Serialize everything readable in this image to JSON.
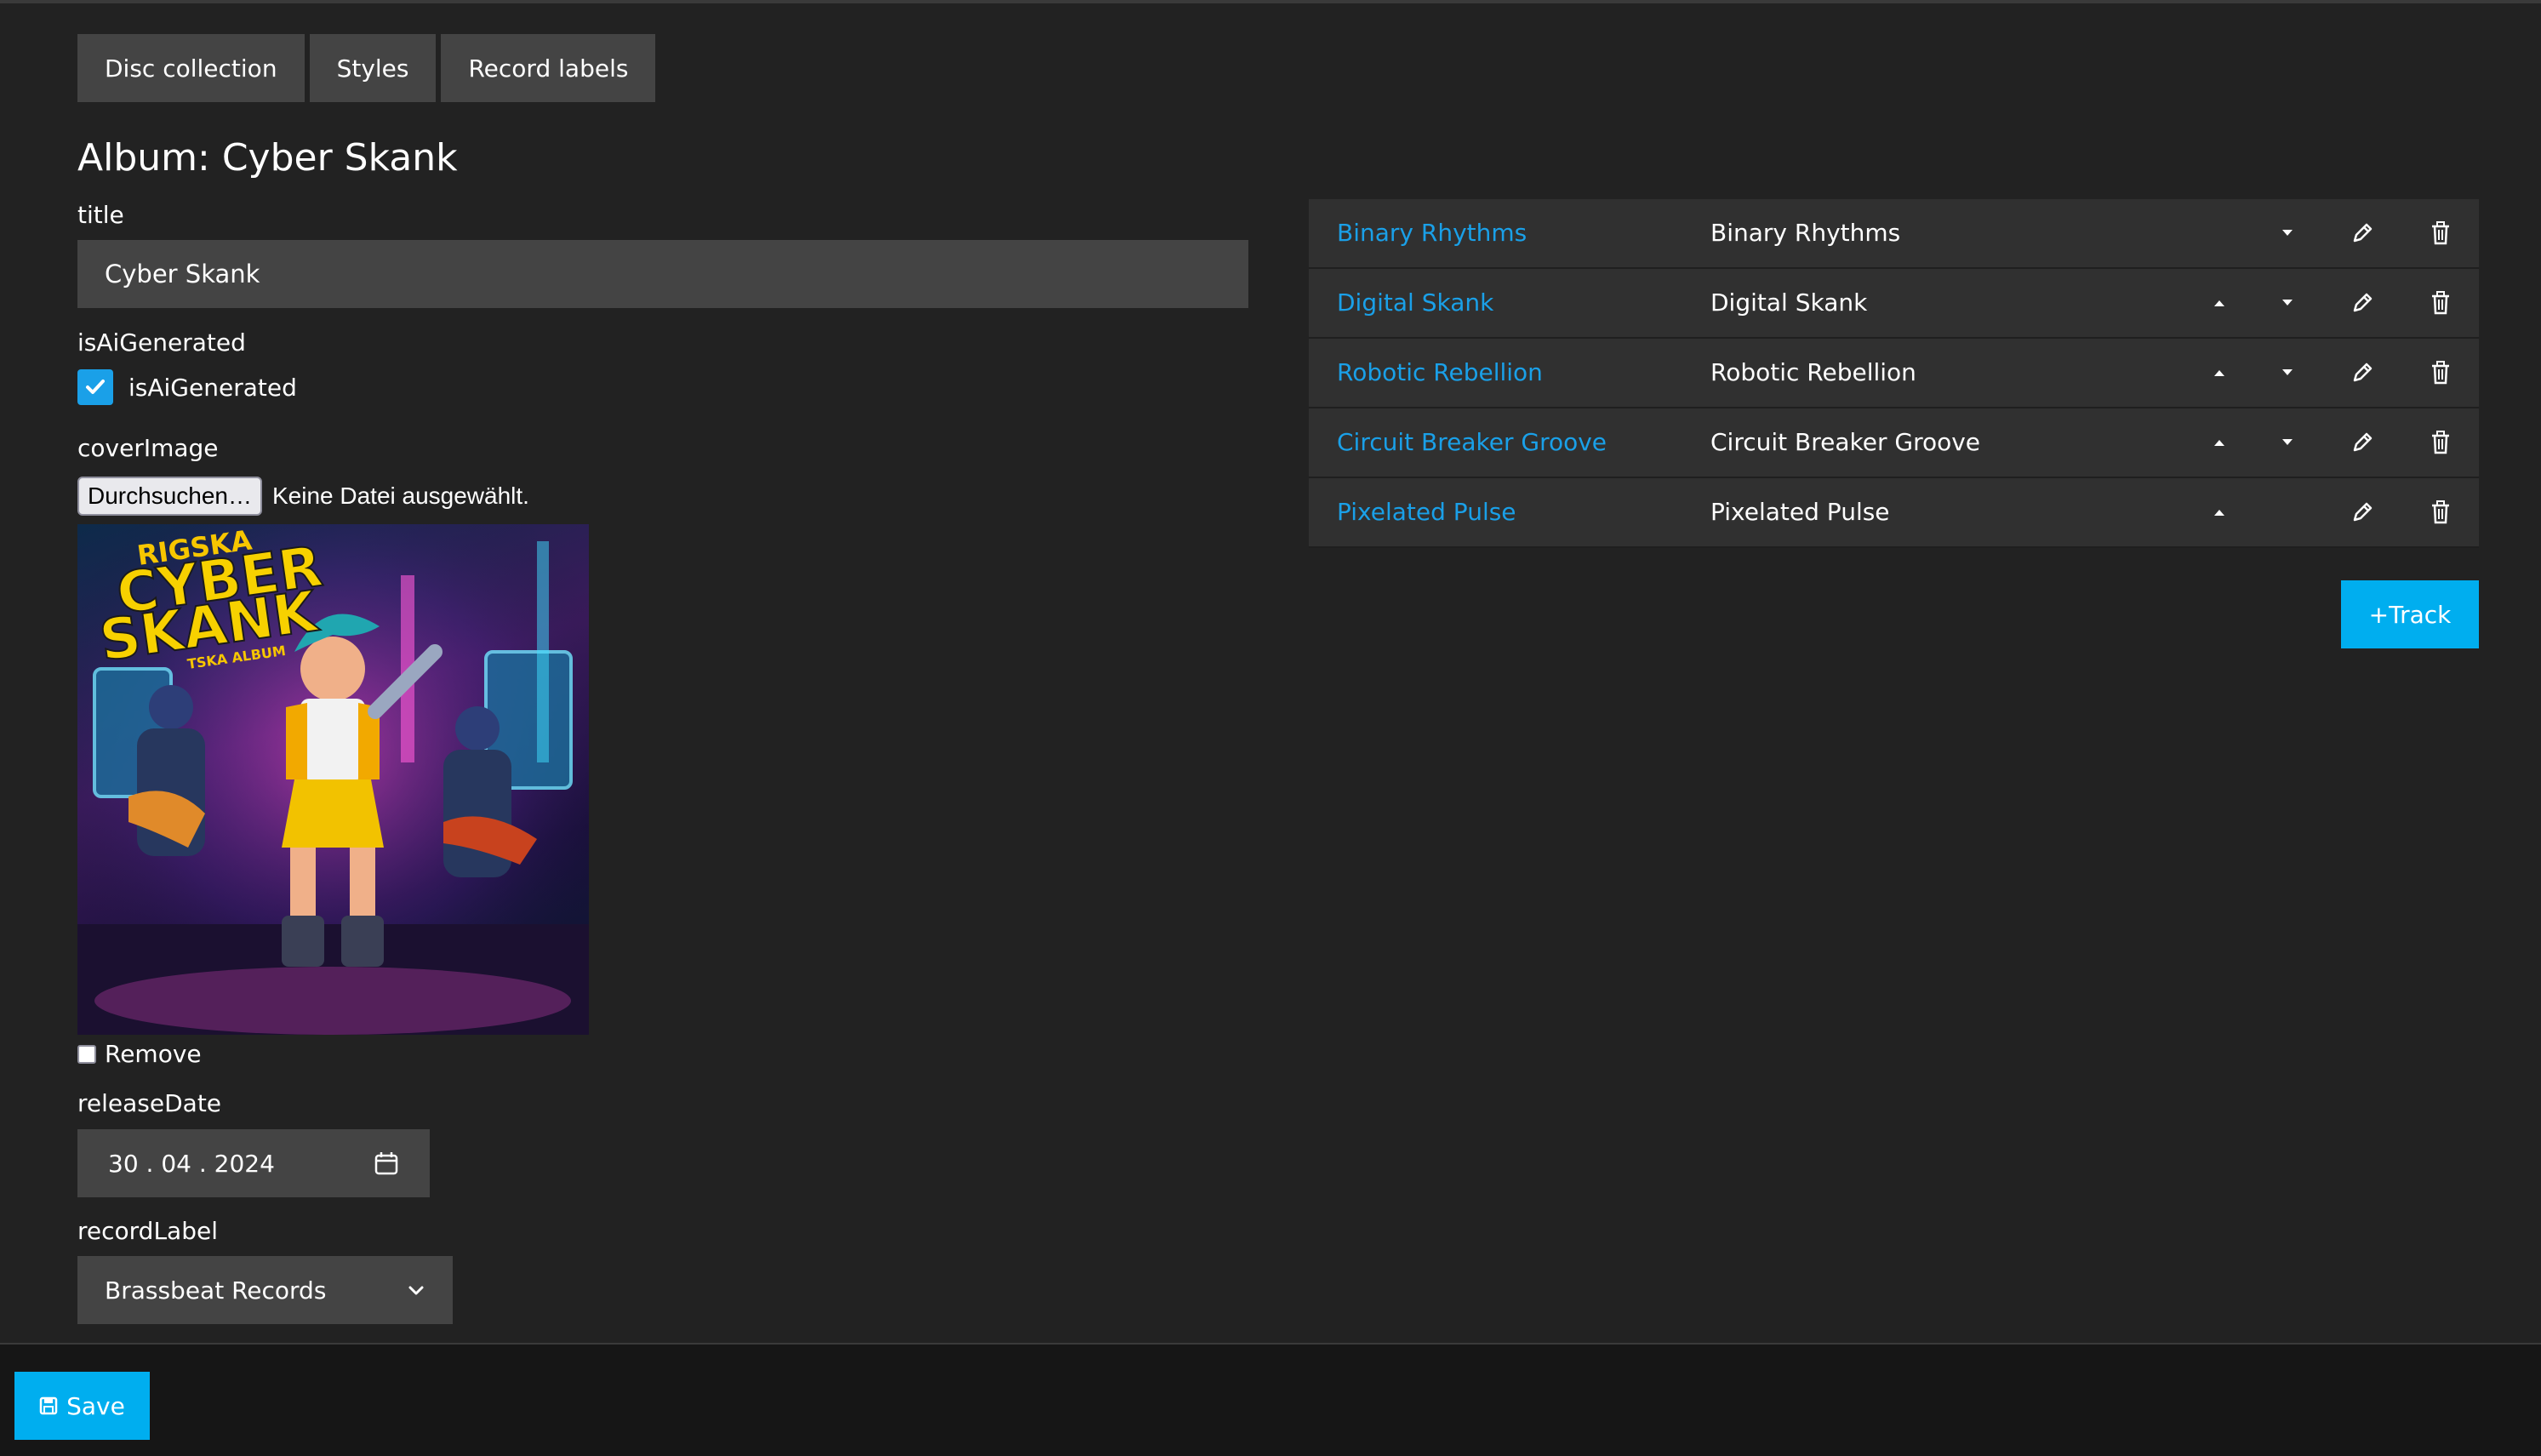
{
  "nav": {
    "items": [
      "Disc collection",
      "Styles",
      "Record labels"
    ]
  },
  "page": {
    "title": "Album: Cyber Skank"
  },
  "form": {
    "title_label": "title",
    "title_value": "Cyber Skank",
    "ai_label": "isAiGenerated",
    "ai_checkbox_label": "isAiGenerated",
    "ai_checked": true,
    "cover_label": "coverImage",
    "file_button": "Durchsuchen…",
    "file_status": "Keine Datei ausgewählt.",
    "cover_art": {
      "line1": "RIGSKA",
      "line2": "CYBER",
      "line3": "SKANK",
      "line4": "TSKA ALBUM"
    },
    "remove_label": "Remove",
    "release_label": "releaseDate",
    "release_value": "30 . 04 . 2024",
    "label_label": "recordLabel",
    "label_value": "Brassbeat Records"
  },
  "tracks": [
    {
      "link": "Binary Rhythms",
      "name": "Binary Rhythms",
      "up": false,
      "down": true
    },
    {
      "link": "Digital Skank",
      "name": "Digital Skank",
      "up": true,
      "down": true
    },
    {
      "link": "Robotic Rebellion",
      "name": "Robotic Rebellion",
      "up": true,
      "down": true
    },
    {
      "link": "Circuit Breaker Groove",
      "name": "Circuit Breaker Groove",
      "up": true,
      "down": true
    },
    {
      "link": "Pixelated Pulse",
      "name": "Pixelated Pulse",
      "up": true,
      "down": false
    }
  ],
  "actions": {
    "add_track": "+Track",
    "save": "Save"
  },
  "colors": {
    "accent": "#00aeef",
    "link": "#1aa0e8",
    "background": "#222222",
    "field": "#444444"
  }
}
